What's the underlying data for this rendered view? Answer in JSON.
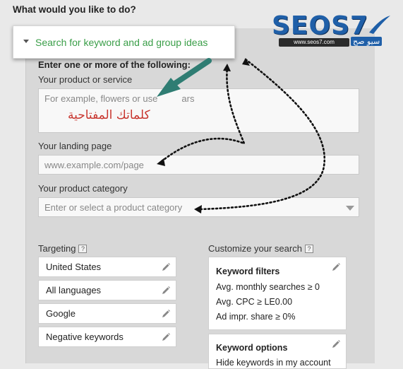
{
  "heading": "What would you like to do?",
  "toggle_label": "Search for keyword and ad group ideas",
  "form": {
    "heading": "Enter one or more of the following:",
    "product_label": "Your product or service",
    "product_placeholder": "For example, flowers or use",
    "product_placeholder_tail": "ars",
    "landing_label": "Your landing page",
    "landing_placeholder": "www.example.com/page",
    "category_label": "Your product category",
    "category_placeholder": "Enter or select a product category"
  },
  "targeting": {
    "label": "Targeting",
    "items": [
      "United States",
      "All languages",
      "Google",
      "Negative keywords"
    ]
  },
  "customize": {
    "label": "Customize your search",
    "keyword_filters": {
      "title": "Keyword filters",
      "rows": [
        "Avg. monthly searches ≥ 0",
        "Avg. CPC ≥ LE0.00",
        "Ad impr. share ≥ 0%"
      ]
    },
    "keyword_options": {
      "title": "Keyword options",
      "rows": [
        "Hide keywords in my account"
      ]
    }
  },
  "annotation": {
    "arabic_text": "كلماتك المفتاحية",
    "logo_text": "SEOS7",
    "logo_url": "www.seos7.com",
    "logo_tag": "سيو صح"
  },
  "help_glyph": "?",
  "colors": {
    "toggle_text": "#3a9e48",
    "annotation_red": "#c8352e",
    "arrow_teal": "#2f7d73",
    "logo_blue": "#1f5fa8"
  }
}
